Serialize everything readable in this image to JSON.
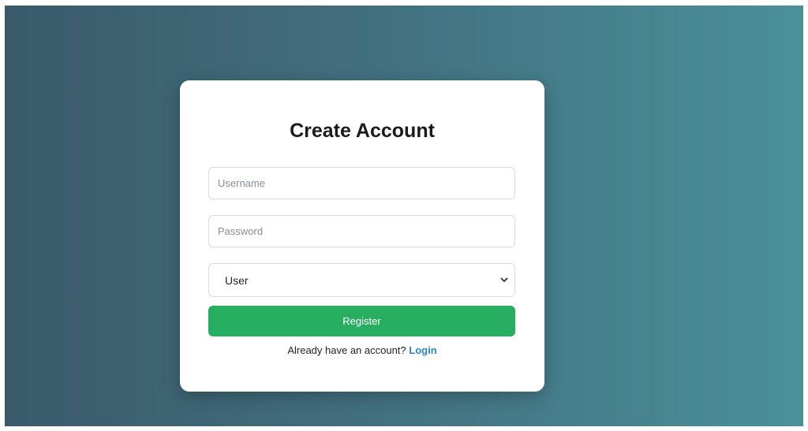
{
  "page": {
    "background_start": "#3a5a6a",
    "background_end": "#4a909b"
  },
  "form": {
    "title": "Create Account",
    "username": {
      "placeholder": "Username",
      "value": ""
    },
    "password": {
      "placeholder": "Password",
      "value": ""
    },
    "role": {
      "selected": "User",
      "icon": "chevron-down-icon"
    },
    "register_label": "Register",
    "register_color": "#27ae60",
    "footer_text": "Already have an account?",
    "login_label": "Login",
    "link_color": "#2e86c1"
  }
}
